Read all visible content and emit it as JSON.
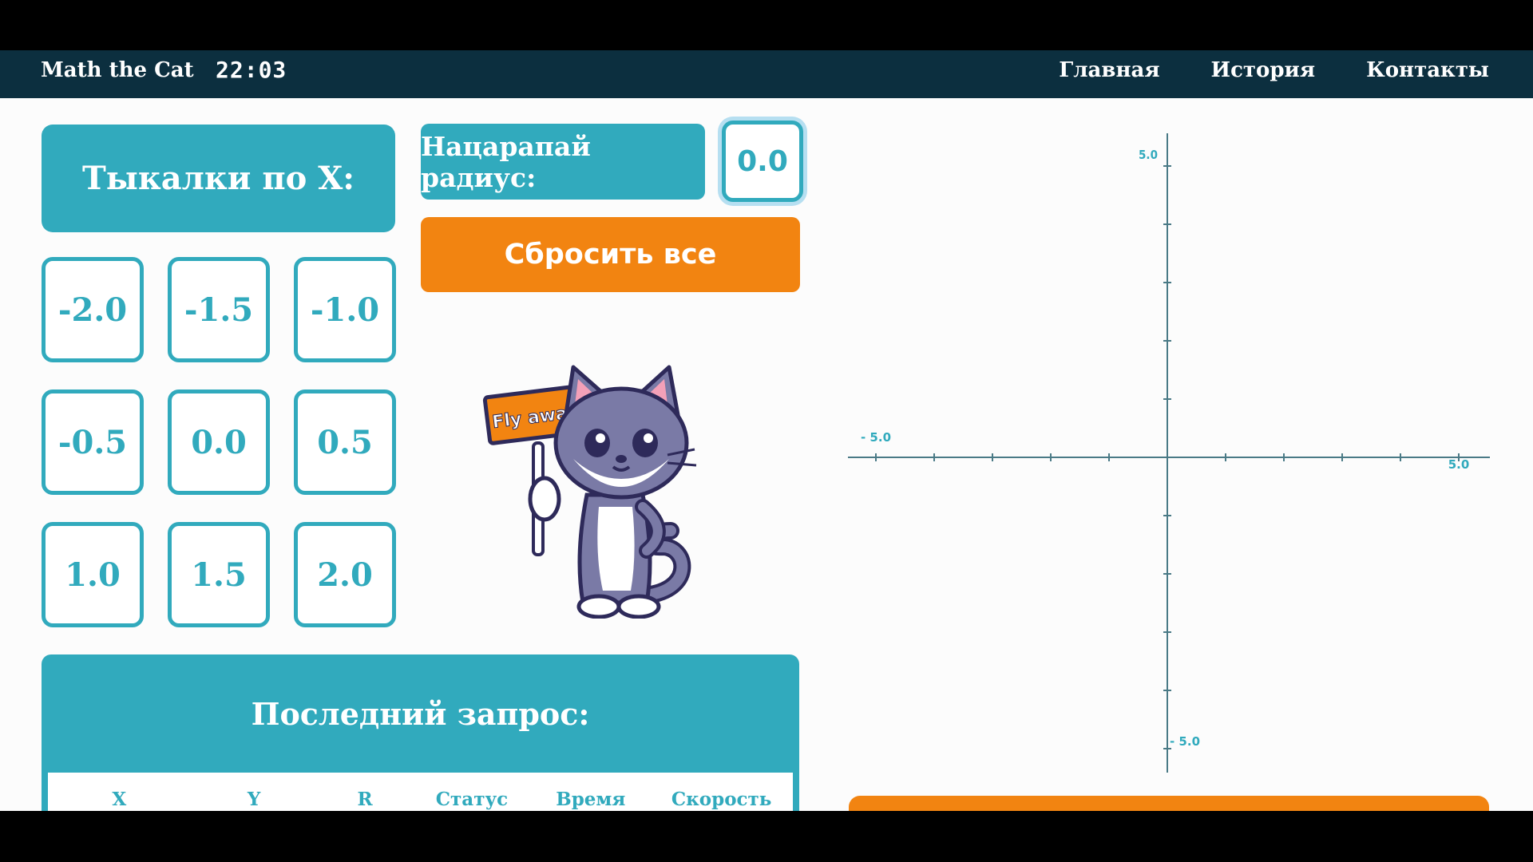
{
  "header": {
    "brand": "Math the Cat",
    "clock": "22:03",
    "nav": [
      "Главная",
      "История",
      "Контакты"
    ]
  },
  "x_selector": {
    "title": "Тыкалки по X:",
    "options": [
      "-2.0",
      "-1.5",
      "-1.0",
      "-0.5",
      "0.0",
      "0.5",
      "1.0",
      "1.5",
      "2.0"
    ]
  },
  "radius": {
    "label": "Нацарапай радиус:",
    "value": "0.0"
  },
  "reset_label": "Сбросить все",
  "mascot": {
    "sign_text": "Fly away!"
  },
  "last_request": {
    "title": "Последний запрос:",
    "columns": [
      "X",
      "Y",
      "R",
      "Статус",
      "Время",
      "Скорость"
    ]
  },
  "plot": {
    "y_max_label": "5.0",
    "y_min_label": "- 5.0",
    "x_min_label": "- 5.0",
    "x_max_label": "5.0"
  },
  "colors": {
    "teal": "#31aabd",
    "orange": "#f28411",
    "header": "#0c2f3f"
  }
}
